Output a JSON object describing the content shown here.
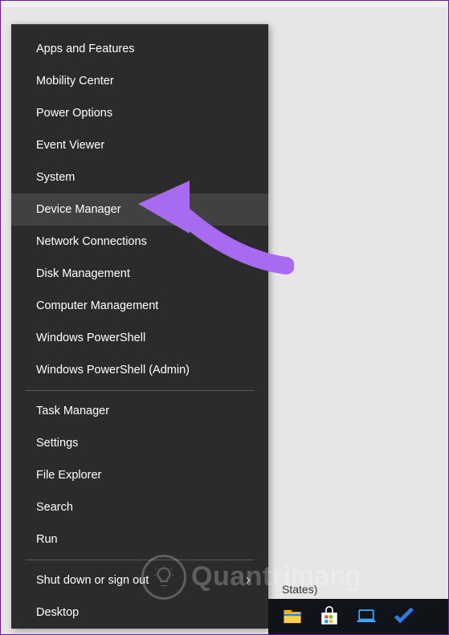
{
  "menu": {
    "groups": [
      {
        "items": [
          {
            "label": "Apps and Features",
            "id": "apps-features",
            "submenu": false,
            "hover": false
          },
          {
            "label": "Mobility Center",
            "id": "mobility-center",
            "submenu": false,
            "hover": false
          },
          {
            "label": "Power Options",
            "id": "power-options",
            "submenu": false,
            "hover": false
          },
          {
            "label": "Event Viewer",
            "id": "event-viewer",
            "submenu": false,
            "hover": false
          },
          {
            "label": "System",
            "id": "system",
            "submenu": false,
            "hover": false
          },
          {
            "label": "Device Manager",
            "id": "device-manager",
            "submenu": false,
            "hover": true
          },
          {
            "label": "Network Connections",
            "id": "network-connections",
            "submenu": false,
            "hover": false
          },
          {
            "label": "Disk Management",
            "id": "disk-management",
            "submenu": false,
            "hover": false
          },
          {
            "label": "Computer Management",
            "id": "computer-management",
            "submenu": false,
            "hover": false
          },
          {
            "label": "Windows PowerShell",
            "id": "powershell",
            "submenu": false,
            "hover": false
          },
          {
            "label": "Windows PowerShell (Admin)",
            "id": "powershell-admin",
            "submenu": false,
            "hover": false
          }
        ]
      },
      {
        "items": [
          {
            "label": "Task Manager",
            "id": "task-manager",
            "submenu": false,
            "hover": false
          },
          {
            "label": "Settings",
            "id": "settings",
            "submenu": false,
            "hover": false
          },
          {
            "label": "File Explorer",
            "id": "file-explorer",
            "submenu": false,
            "hover": false
          },
          {
            "label": "Search",
            "id": "search",
            "submenu": false,
            "hover": false
          },
          {
            "label": "Run",
            "id": "run",
            "submenu": false,
            "hover": false
          }
        ]
      },
      {
        "items": [
          {
            "label": "Shut down or sign out",
            "id": "shutdown-signout",
            "submenu": true,
            "hover": false
          },
          {
            "label": "Desktop",
            "id": "desktop",
            "submenu": false,
            "hover": false
          }
        ]
      }
    ]
  },
  "language_indicator": "States)",
  "taskbar": {
    "items": [
      {
        "icon": "file-explorer-icon"
      },
      {
        "icon": "store-icon"
      },
      {
        "icon": "laptop-icon"
      },
      {
        "icon": "check-icon"
      }
    ]
  },
  "annotation": {
    "arrow_color": "#a96af2"
  },
  "watermark": {
    "text_prefix": "Quantri",
    "text_suffix": "mang"
  }
}
